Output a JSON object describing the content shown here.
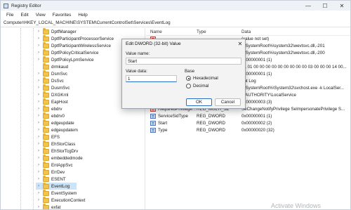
{
  "window": {
    "title": "Registry Editor",
    "controls": {
      "minimize": "—",
      "maximize": "☐",
      "close": "✕"
    }
  },
  "menu": [
    "File",
    "Edit",
    "View",
    "Favorites",
    "Help"
  ],
  "address": "Computer\\HKEY_LOCAL_MACHINE\\SYSTEM\\CurrentControlSet\\Services\\EventLog",
  "tree": {
    "items": [
      {
        "label": "DptfManager",
        "expandable": true
      },
      {
        "label": "DptfParticipantProcessorService",
        "expandable": true
      },
      {
        "label": "DptfParticipantWirelessService",
        "expandable": true
      },
      {
        "label": "DptfPolicyCriticalService",
        "expandable": true
      },
      {
        "label": "DptfPolicyLpmService",
        "expandable": true
      },
      {
        "label": "drmkaud",
        "expandable": false
      },
      {
        "label": "DsmSvc",
        "expandable": true
      },
      {
        "label": "DsSvc",
        "expandable": true
      },
      {
        "label": "DusmSvc",
        "expandable": true
      },
      {
        "label": "DXGKrnl",
        "expandable": true
      },
      {
        "label": "EapHost",
        "expandable": true
      },
      {
        "label": "ebdrv",
        "expandable": true
      },
      {
        "label": "ebdrv0",
        "expandable": true
      },
      {
        "label": "edgeupdate",
        "expandable": true
      },
      {
        "label": "edgeupdatem",
        "expandable": true
      },
      {
        "label": "EFS",
        "expandable": true
      },
      {
        "label": "EhStorClass",
        "expandable": true
      },
      {
        "label": "EhStorTcgDrv",
        "expandable": true
      },
      {
        "label": "embeddedmode",
        "expandable": true
      },
      {
        "label": "EntAppSvc",
        "expandable": true
      },
      {
        "label": "ErrDev",
        "expandable": true
      },
      {
        "label": "ESENT",
        "expandable": true
      },
      {
        "label": "EventLog",
        "expandable": true,
        "selected": true
      },
      {
        "label": "EventSystem",
        "expandable": true
      },
      {
        "label": "ExecutionContext",
        "expandable": true
      },
      {
        "label": "exfat",
        "expandable": true
      }
    ]
  },
  "list": {
    "columns": {
      "name": "Name",
      "type": "Type",
      "data": "Data"
    },
    "rows": [
      {
        "name": "",
        "type": "",
        "data": "(value not set)",
        "icon": "sz"
      },
      {
        "name": "",
        "type": "",
        "data": "%SystemRoot%\\system32\\wevtsvc.dll,-201",
        "icon": "sz"
      },
      {
        "name": "",
        "type": "",
        "data": "%SystemRoot%\\system32\\wevtsvc.dll,-200",
        "icon": "sz"
      },
      {
        "name": "",
        "type": "",
        "data": "0x00000001 (1)",
        "icon": "dword"
      },
      {
        "name": "",
        "type": "",
        "data": "51 01 00 00 00 00 00 00 00 00 00 03 00 00 00 14 00...",
        "icon": "bin"
      },
      {
        "name": "",
        "type": "",
        "data": "0x00000001 (1)",
        "icon": "dword"
      },
      {
        "name": "",
        "type": "",
        "data": "ent Log",
        "icon": "sz"
      },
      {
        "name": "",
        "type": "",
        "data": "%SystemRoot%\\System32\\svchost.exe -k LocalSer...",
        "icon": "sz"
      },
      {
        "name": "",
        "type": "",
        "data": "T AUTHORITY\\LocalService",
        "icon": "sz"
      },
      {
        "name": "",
        "type": "",
        "data": "0x00000003 (3)",
        "icon": "dword"
      },
      {
        "name": "RequiredPrivilege...",
        "type": "REG_MULTI_SZ",
        "data": "SeChangeNotifyPrivilege SeImpersonatePrivilege S...",
        "icon": "sz"
      },
      {
        "name": "ServiceSidType",
        "type": "REG_DWORD",
        "data": "0x00000001 (1)",
        "icon": "dword"
      },
      {
        "name": "Start",
        "type": "REG_DWORD",
        "data": "0x00000002 (2)",
        "icon": "dword"
      },
      {
        "name": "Type",
        "type": "REG_DWORD",
        "data": "0x00000020 (32)",
        "icon": "dword"
      }
    ]
  },
  "dialog": {
    "title": "Edit DWORD (32-bit) Value",
    "value_name_label": "Value name:",
    "value_name": "Start",
    "value_data_label": "Value data:",
    "value_data": "1",
    "base_label": "Base",
    "hex_label": "Hexadecimal",
    "dec_label": "Decimal",
    "base_selected": "Hexadecimal",
    "ok_label": "OK",
    "cancel_label": "Cancel"
  },
  "watermark": "Activate Windows",
  "colors": {
    "selection": "#cce4f7",
    "accent": "#2a6fc6",
    "folder": "#f2c44e"
  }
}
